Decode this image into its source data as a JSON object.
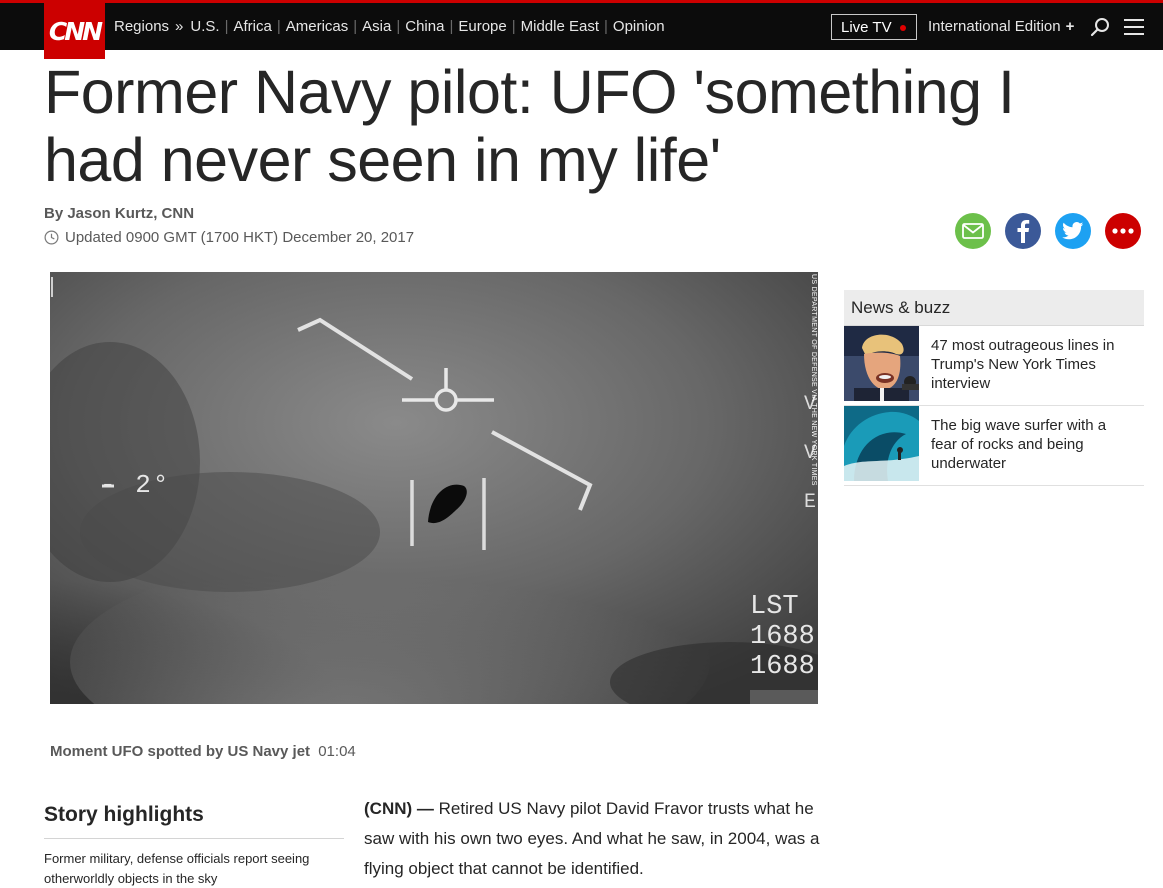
{
  "nav": {
    "logo_text": "CNN",
    "regions_label": "Regions",
    "raquo": "»",
    "links": [
      "U.S.",
      "Africa",
      "Americas",
      "Asia",
      "China",
      "Europe",
      "Middle East",
      "Opinion"
    ],
    "live_tv": "Live TV",
    "edition": "International Edition",
    "edition_plus": "+"
  },
  "article": {
    "headline": "Former Navy pilot: UFO 'something I had never seen in my life'",
    "byline": "By Jason Kurtz, CNN",
    "updated": "Updated 0900 GMT (1700 HKT) December 20, 2017"
  },
  "share": {
    "icons": [
      "email-icon",
      "facebook-icon",
      "twitter-icon",
      "more-icon"
    ]
  },
  "video": {
    "hud_heading": "- 2°",
    "hud_right": [
      "LST",
      "1688",
      "1688"
    ],
    "credit": "US DEPARTMENT OF DEFENSE VIA THE NEW YORK TIMES",
    "caption_title": "Moment UFO spotted by US Navy jet",
    "caption_duration": "01:04"
  },
  "buzz": {
    "header": "News & buzz",
    "items": [
      {
        "text": "47 most outrageous lines in Trump's New York Times interview"
      },
      {
        "text": "The big wave surfer with a fear of rocks and being underwater"
      }
    ]
  },
  "highlights": {
    "title": "Story highlights",
    "items": [
      "Former military, defense officials report seeing otherworldly objects in the sky"
    ]
  },
  "body": {
    "source": "(CNN) —",
    "text": "Retired US Navy pilot David Fravor trusts what he saw with his own two eyes. And what he saw, in 2004, was a flying object that cannot be identified."
  },
  "colors": {
    "brand": "#cc0000",
    "nav_bg": "#0c0c0c",
    "email": "#6cc04a",
    "facebook": "#3b5998",
    "twitter": "#1da1f2"
  }
}
